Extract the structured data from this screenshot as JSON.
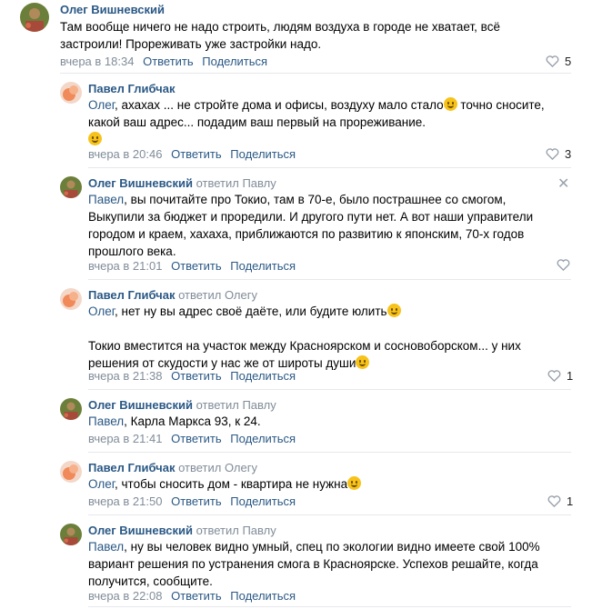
{
  "actions": {
    "reply": "Ответить",
    "share": "Поделиться"
  },
  "comments": [
    {
      "author": "Олег Вишневский",
      "text": "Там вообще ничего не надо строить, людям воздуха в городе не хватает, всё застроили! Прореживать уже застройки надо.",
      "time": "вчера в 18:34",
      "likes": "5"
    },
    {
      "author": "Павел Глибчак",
      "mention": "Олег",
      "text": ", ахахах ... не стройте дома и офисы, воздуху мало стало",
      "text2": " точно сносите, какой ваш адрес... подадим ваш первый на прореживание.",
      "time": "вчера в 20:46",
      "likes": "3"
    },
    {
      "author": "Олег Вишневский",
      "replied": "ответил Павлу",
      "mention": "Павел",
      "text": ", вы почитайте про Токио, там в 70-е, было пострашнее со смогом, Выкупили за бюджет и проредили. И другого пути нет. А вот наши управители городом и краем, хахаха, приближаются по развитию к японским, 70-х годов прошлого века.",
      "time": "вчера в 21:01",
      "likes": ""
    },
    {
      "author": "Павел Глибчак",
      "replied": "ответил Олегу",
      "mention": "Олег",
      "text": ", нет ну вы адрес своё даёте, или будите юлить",
      "text2": "Токио вместится на участок между Красноярском и сосновоборском... у них решения от скудости у нас же от широты души",
      "time": "вчера в 21:38",
      "likes": "1"
    },
    {
      "author": "Олег Вишневский",
      "replied": "ответил Павлу",
      "mention": "Павел",
      "text": ", Карла Маркса 93, к 24.",
      "time": "вчера в 21:41",
      "likes": ""
    },
    {
      "author": "Павел Глибчак",
      "replied": "ответил Олегу",
      "mention": "Олег",
      "text": ", чтобы сносить дом - квартира не нужна",
      "time": "вчера в 21:50",
      "likes": "1"
    },
    {
      "author": "Олег Вишневский",
      "replied": "ответил Павлу",
      "mention": "Павел",
      "text": ", ну вы человек видно умный, спец по экологии видно имеете свой 100% вариант решения по устранения смога в Красноярске. Успехов решайте, когда получится, сообщите.",
      "time": "вчера в 22:08",
      "likes": ""
    }
  ]
}
